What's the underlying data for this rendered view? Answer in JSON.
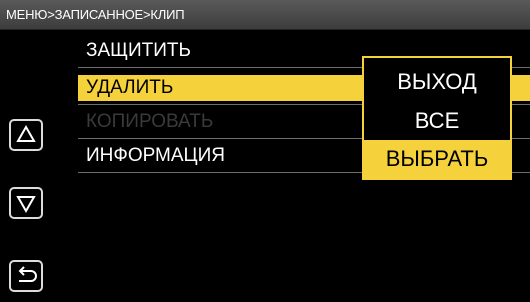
{
  "header": {
    "breadcrumb": "МЕНЮ>ЗАПИСАННОЕ>КЛИП"
  },
  "menu": {
    "items": [
      {
        "label": "ЗАЩИТИТЬ",
        "state": "normal"
      },
      {
        "label": "УДАЛИТЬ",
        "state": "selected"
      },
      {
        "label": "КОПИРОВАТЬ",
        "state": "disabled"
      },
      {
        "label": "ИНФОРМАЦИЯ",
        "state": "normal"
      }
    ]
  },
  "popup": {
    "items": [
      {
        "label": "ВЫХОД",
        "state": "normal"
      },
      {
        "label": "ВСЕ",
        "state": "normal"
      },
      {
        "label": "ВЫБРАТЬ",
        "state": "selected"
      }
    ]
  },
  "side_buttons": {
    "up": "up-triangle-icon",
    "down": "down-triangle-icon",
    "back": "return-arrow-icon"
  },
  "colors": {
    "accent": "#f5d23b",
    "background": "#000000",
    "header": "#4a4a4a",
    "disabled_text": "#3a3a3a"
  }
}
